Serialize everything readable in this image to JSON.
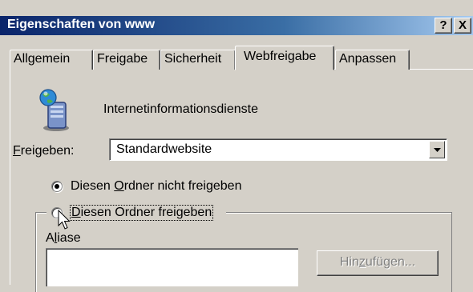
{
  "window": {
    "title": "Eigenschaften von www",
    "help_label": "?",
    "close_label": "X"
  },
  "tabs": [
    {
      "label": "Allgemein",
      "active": false
    },
    {
      "label": "Freigabe",
      "active": false
    },
    {
      "label": "Sicherheit",
      "active": false
    },
    {
      "label": "Webfreigabe",
      "active": true
    },
    {
      "label": "Anpassen",
      "active": false
    }
  ],
  "service": {
    "icon": "iis-server-icon",
    "label": "Internetinformationsdienste"
  },
  "share": {
    "label_prefix": "F",
    "label_rest": "reigeben:",
    "selected_value": "Standardwebsite"
  },
  "options": {
    "not_shared": {
      "prefix": "Diesen ",
      "accel": "O",
      "rest": "rdner nicht freigeben",
      "checked": true
    },
    "shared": {
      "prefix": "",
      "accel": "D",
      "rest": "iesen Ordner freigeben",
      "checked": false
    }
  },
  "aliases": {
    "label_prefix": "A",
    "label_accel": "l",
    "label_rest": "iase",
    "add_button_prefix": "Hin",
    "add_button_accel": "z",
    "add_button_rest": "ufügen...",
    "add_button_enabled": false
  },
  "colors": {
    "title_bar_start": "#0a246a",
    "title_bar_end": "#a6caf0",
    "window_face": "#d4d0c8",
    "disabled_text": "#808080"
  }
}
